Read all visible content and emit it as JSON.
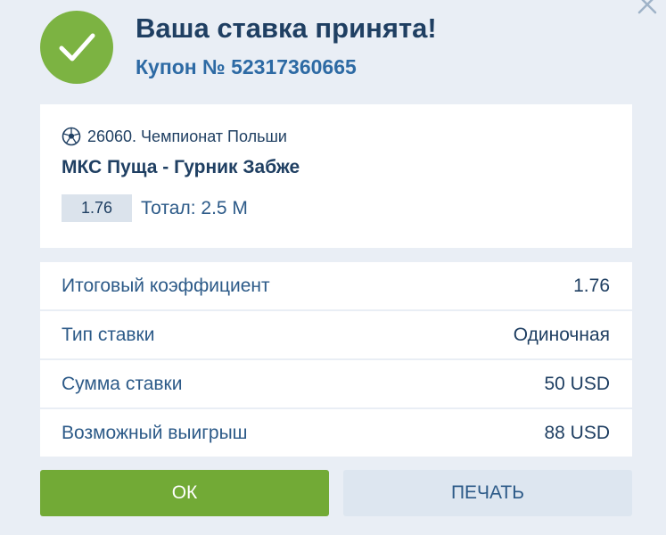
{
  "header": {
    "title": "Ваша ставка принята!",
    "coupon": "Купон № 52317360665",
    "success_icon": "checkmark-icon",
    "close_icon": "close-icon"
  },
  "event": {
    "league_icon": "soccer-ball-icon",
    "league": "26060. Чемпионат Польши",
    "match": "МКС Пуща - Гурник Забже",
    "odds": "1.76",
    "market": "Тотал: 2.5 М"
  },
  "details": [
    {
      "label": "Итоговый коэффициент",
      "value": "1.76"
    },
    {
      "label": "Тип ставки",
      "value": "Одиночная"
    },
    {
      "label": "Сумма ставки",
      "value": "50 USD"
    },
    {
      "label": "Возможный выигрыш",
      "value": "88 USD"
    }
  ],
  "buttons": {
    "ok": "ОК",
    "print": "ПЕЧАТЬ"
  },
  "colors": {
    "success_green": "#7cb342",
    "ok_button": "#72aa36",
    "title_navy": "#1f3f62",
    "accent_blue": "#2d6aa4",
    "background": "#e9eef5"
  }
}
